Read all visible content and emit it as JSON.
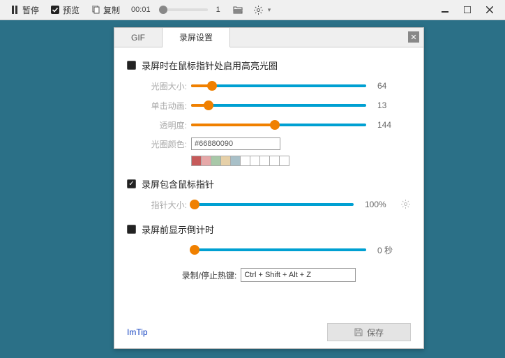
{
  "toolbar": {
    "pause": "暂停",
    "preview": "预览",
    "copy": "复制",
    "time": "00:01",
    "frames": "1"
  },
  "tabs": {
    "gif": "GIF",
    "rec": "录屏设置"
  },
  "sec1": {
    "title": "录屏时在鼠标指针处启用高亮光圈",
    "size_label": "光圈大小:",
    "size_val": "64",
    "size_pct": 12,
    "click_label": "单击动画:",
    "click_val": "13",
    "click_pct": 10,
    "opacity_label": "透明度:",
    "opacity_val": "144",
    "opacity_pct": 48,
    "color_label": "光圈颜色:",
    "color_hex": "#66880090",
    "swatches": [
      "#c65a5a",
      "#e6a8a8",
      "#a8c8a8",
      "#e6d0a8",
      "#a8c0c8",
      "#ffffff",
      "#ffffff",
      "#ffffff",
      "#ffffff",
      "#ffffff"
    ]
  },
  "sec2": {
    "title": "录屏包含鼠标指针",
    "ptr_label": "指针大小:",
    "ptr_val": "100%",
    "ptr_pct": 2
  },
  "sec3": {
    "title": "录屏前显示倒计时",
    "cd_val": "0 秒",
    "cd_pct": 2
  },
  "hotkey": {
    "label": "录制/停止热键:",
    "value": "Ctrl + Shift + Alt + Z"
  },
  "footer": {
    "imtip": "ImTip",
    "save": "保存"
  }
}
